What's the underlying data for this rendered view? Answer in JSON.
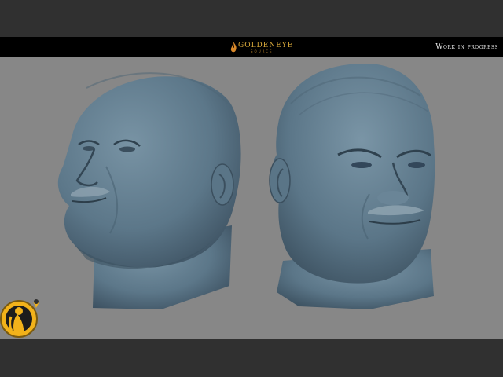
{
  "header": {
    "logo_text": "GOLDENEYE",
    "logo_subtext": "SOURCE",
    "status": "Work in progress"
  },
  "colors": {
    "background_outer": "#2f2f2f",
    "viewport": "#878787",
    "header_bar": "#000000",
    "model_skin": "#5f7a8c",
    "logo_gold": "#d8a83a",
    "badge_yellow": "#f2b21a"
  },
  "viewport": {
    "subjects": [
      "head-sculpt-three-quarter-view",
      "head-sculpt-front-view"
    ]
  },
  "badge": {
    "icon": "gesource-emblem-icon"
  }
}
